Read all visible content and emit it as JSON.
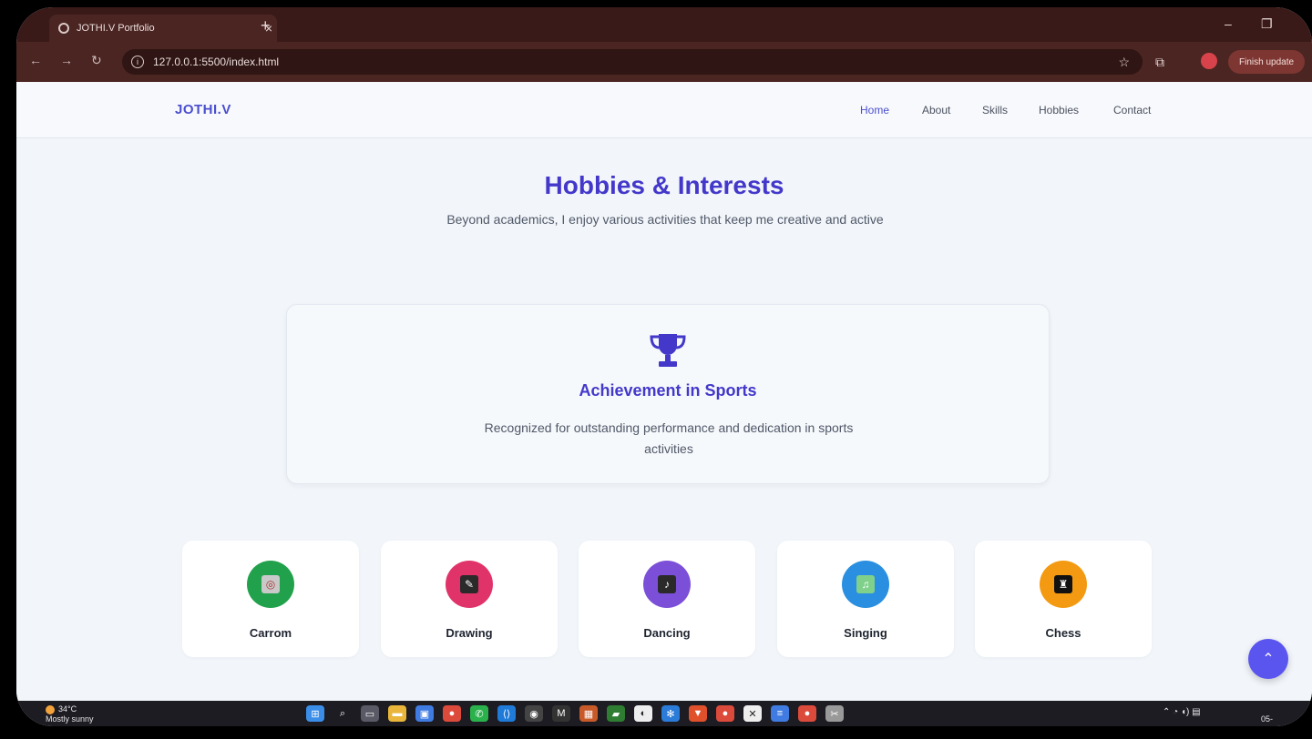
{
  "browser": {
    "tab_title": "JOTHI.V Portfolio",
    "tab_close": "×",
    "new_tab": "+",
    "url": "127.0.0.1:5500/index.html",
    "finish_update": "Finish update",
    "minimize": "–",
    "restore": "❐"
  },
  "site": {
    "brand": "JOTHI.V",
    "nav": [
      "Home",
      "About",
      "Skills",
      "Hobbies",
      "Contact"
    ],
    "active_nav": "Home",
    "accent_color": "#4338ca"
  },
  "hobbies_section": {
    "title": "Hobbies & Interests",
    "subtitle": "Beyond academics, I enjoy various activities that keep me creative and active",
    "achievement": {
      "icon": "trophy-icon",
      "title": "Achievement in Sports",
      "description": "Recognized for outstanding performance and dedication in sports activities"
    },
    "hobbies": [
      {
        "name": "Carrom",
        "icon": "carrom-icon",
        "color": "#22a14d"
      },
      {
        "name": "Drawing",
        "icon": "drawing-icon",
        "color": "#e0336a"
      },
      {
        "name": "Dancing",
        "icon": "dancing-icon",
        "color": "#7c4fd8"
      },
      {
        "name": "Singing",
        "icon": "singing-icon",
        "color": "#2a8fe0"
      },
      {
        "name": "Chess",
        "icon": "chess-icon",
        "color": "#f39a12"
      }
    ]
  },
  "scroll_top": "⌃",
  "taskbar": {
    "temperature": "34°C",
    "weather": "Mostly sunny",
    "clock_date": "05-"
  }
}
